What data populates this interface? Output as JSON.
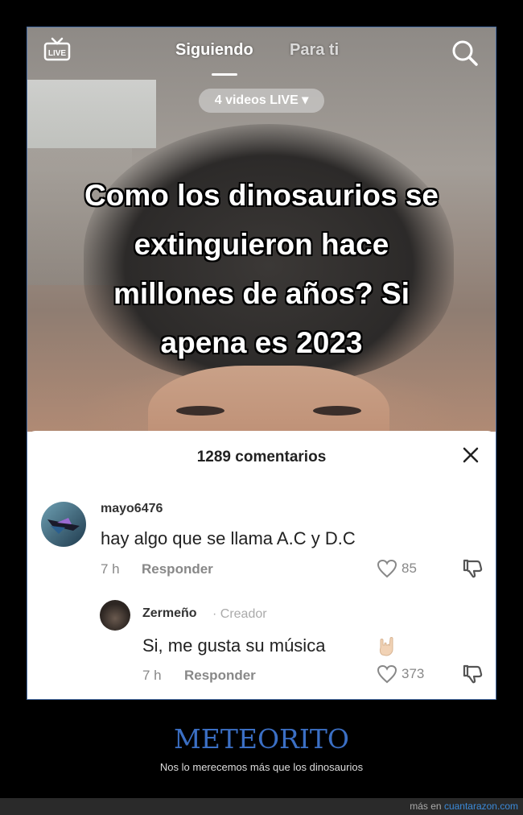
{
  "topbar": {
    "live_icon": "live-tv-icon",
    "tab_following": "Siguiendo",
    "tab_foryou": "Para ti",
    "search_icon": "search-icon"
  },
  "live_pill": "4 videos LIVE ▾",
  "caption": [
    "Como los dinosaurios se",
    "extinguieron hace",
    "millones de años? Si",
    "apena es 2023"
  ],
  "comments_panel": {
    "count_label": "1289 comentarios",
    "close_icon": "close-icon",
    "comments": [
      {
        "username": "mayo6476",
        "text": "hay algo que se llama A.C y D.C",
        "time": "7 h",
        "reply_label": "Responder",
        "likes": "85"
      },
      {
        "username": "Zermeño",
        "creator_tag": "· Creador",
        "text": "Si, me gusta su música",
        "emoji_icon": "rock-hand-icon",
        "time": "7 h",
        "reply_label": "Responder",
        "likes": "373"
      }
    ]
  },
  "post": {
    "title": "METEORITO",
    "subtitle": "Nos lo merecemos más que los dinosaurios"
  },
  "footer": {
    "prefix": "más en",
    "site": "cuantarazon.com"
  },
  "colors": {
    "title_blue": "#3b6fc4",
    "link_blue": "#3b8ad9",
    "frame_border": "#4a6fa5"
  }
}
